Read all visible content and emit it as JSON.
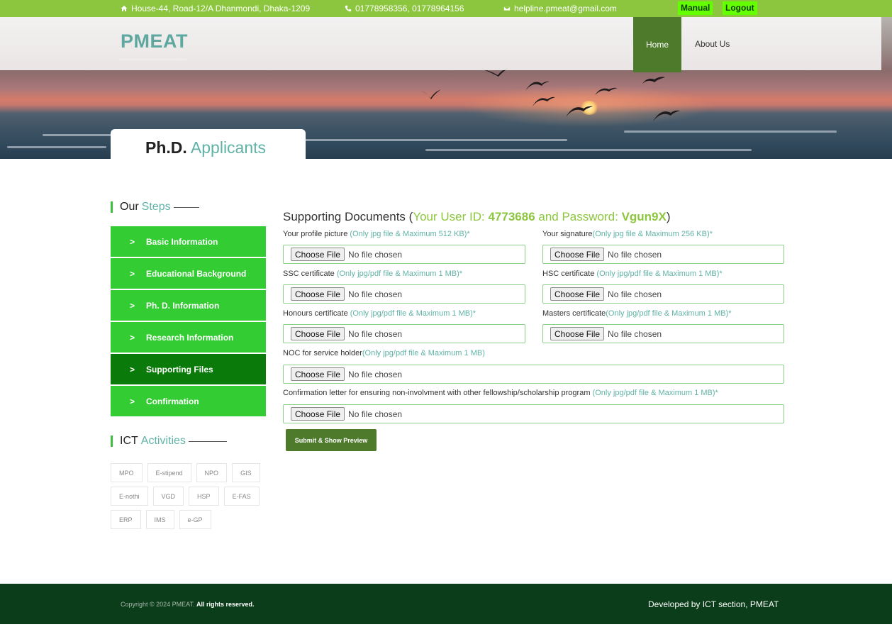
{
  "topbar": {
    "address": "House-44, Road-12/A Dhanmondi, Dhaka-1209",
    "phone": "01778958356, 01778964156",
    "email": "helpline.pmeat@gmail.com",
    "manual": "Manual",
    "logout": "Logout",
    "bg_color": "#8cc63f",
    "button_color": "#64ff00"
  },
  "header": {
    "logo": "PMEAT",
    "nav": {
      "home": "Home",
      "about": "About Us"
    }
  },
  "page_title": {
    "bold": "Ph.D.",
    "rest": "Applicants"
  },
  "sidebar": {
    "steps_head": {
      "a": "Our",
      "b": "Steps"
    },
    "steps": [
      {
        "label": "Basic Information",
        "active": false
      },
      {
        "label": "Educational Background",
        "active": false
      },
      {
        "label": "Ph. D. Information",
        "active": false
      },
      {
        "label": "Research Information",
        "active": false
      },
      {
        "label": "Supporting Files",
        "active": true
      },
      {
        "label": "Confirmation",
        "active": false
      }
    ],
    "ict_head": {
      "a": "ICT",
      "b": "Activities"
    },
    "ict_tags": [
      "MPO",
      "E-stipend",
      "NPO",
      "GIS",
      "E-nothi",
      "VGD",
      "HSP",
      "E-FAS",
      "ERP",
      "IMS",
      "e-GP"
    ]
  },
  "form": {
    "title": "Supporting Documents (",
    "user_id_label": "Your User ID: ",
    "user_id": "4773686",
    "password_label": " and Password: ",
    "password": "Vgun9X",
    "title_end": ")",
    "choose_label": "Choose File",
    "no_file": "No file chosen",
    "fields": {
      "profile": {
        "label": "Your profile picture ",
        "hint": "(Only jpg file & Maximum 512 KB)*"
      },
      "signature": {
        "label": "Your signature",
        "hint": "(Only jpg file & Maximum 256 KB)*"
      },
      "ssc": {
        "label": "SSC certificate ",
        "hint": "(Only jpg/pdf file & Maximum 1 MB)*"
      },
      "hsc": {
        "label": "HSC certificate ",
        "hint": "(Only jpg/pdf file & Maximum 1 MB)*"
      },
      "honours": {
        "label": "Honours certificate ",
        "hint": "(Only jpg/pdf file & Maximum 1 MB)*"
      },
      "masters": {
        "label": "Masters certificate",
        "hint": "(Only jpg/pdf file & Maximum 1 MB)*"
      },
      "noc": {
        "label": "NOC for service holder",
        "hint": "(Only jpg/pdf file & Maximum 1 MB)"
      },
      "confirmation": {
        "label": "Confirmation letter for ensuring non-involvment with other fellowship/scholarship program ",
        "hint": "(Only jpg/pdf file & Maximum 1 MB)*"
      }
    },
    "submit": "Submit & Show Preview"
  },
  "footer": {
    "copyright": "Copyright © 2024 PMEAT. ",
    "rights": "All rights reserved.",
    "developed": "Developed by ICT section, PMEAT"
  },
  "colors": {
    "step_green": "#33cc33",
    "step_active": "#0a7a0a",
    "accent_teal": "#5fb3a6",
    "footer_bg": "#0b3d1a",
    "button_dark": "#4e7a2c"
  }
}
